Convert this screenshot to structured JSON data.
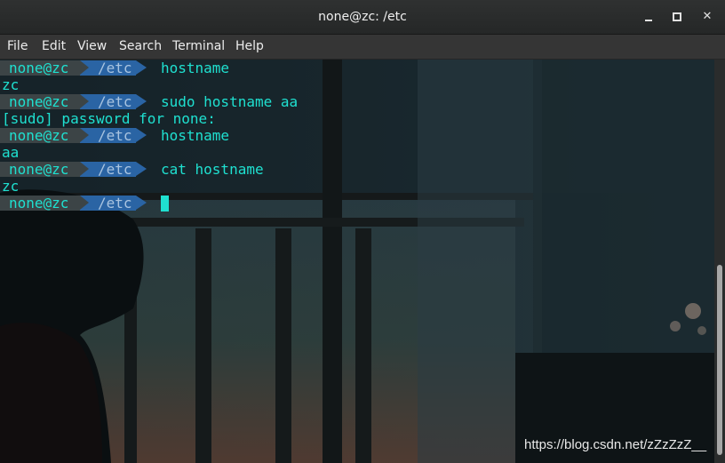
{
  "window": {
    "title": "none@zc: /etc",
    "controls": {
      "minimize_icon": "minimize-icon",
      "maximize_icon": "maximize-icon",
      "close_icon": "close-icon",
      "close_glyph": "✕"
    }
  },
  "menu": [
    "File",
    "Edit",
    "View",
    "Search",
    "Terminal",
    "Help"
  ],
  "prompt": {
    "user": "none@zc",
    "dir": "/etc"
  },
  "terminal_lines": [
    {
      "type": "prompt",
      "cmd": "hostname"
    },
    {
      "type": "output",
      "text": "zc"
    },
    {
      "type": "prompt",
      "cmd": "sudo hostname aa"
    },
    {
      "type": "output",
      "text": "[sudo] password for none:"
    },
    {
      "type": "prompt",
      "cmd": "hostname"
    },
    {
      "type": "output",
      "text": "aa"
    },
    {
      "type": "prompt",
      "cmd": "cat hostname"
    },
    {
      "type": "output",
      "text": "zc"
    },
    {
      "type": "prompt",
      "cmd": "",
      "cursor": true
    }
  ],
  "watermark": "https://blog.csdn.net/zZzZzZ__",
  "colors": {
    "text": "#1fe0d0",
    "prompt_user_bg": "#3c4446",
    "prompt_dir_bg": "#2a64a4"
  }
}
